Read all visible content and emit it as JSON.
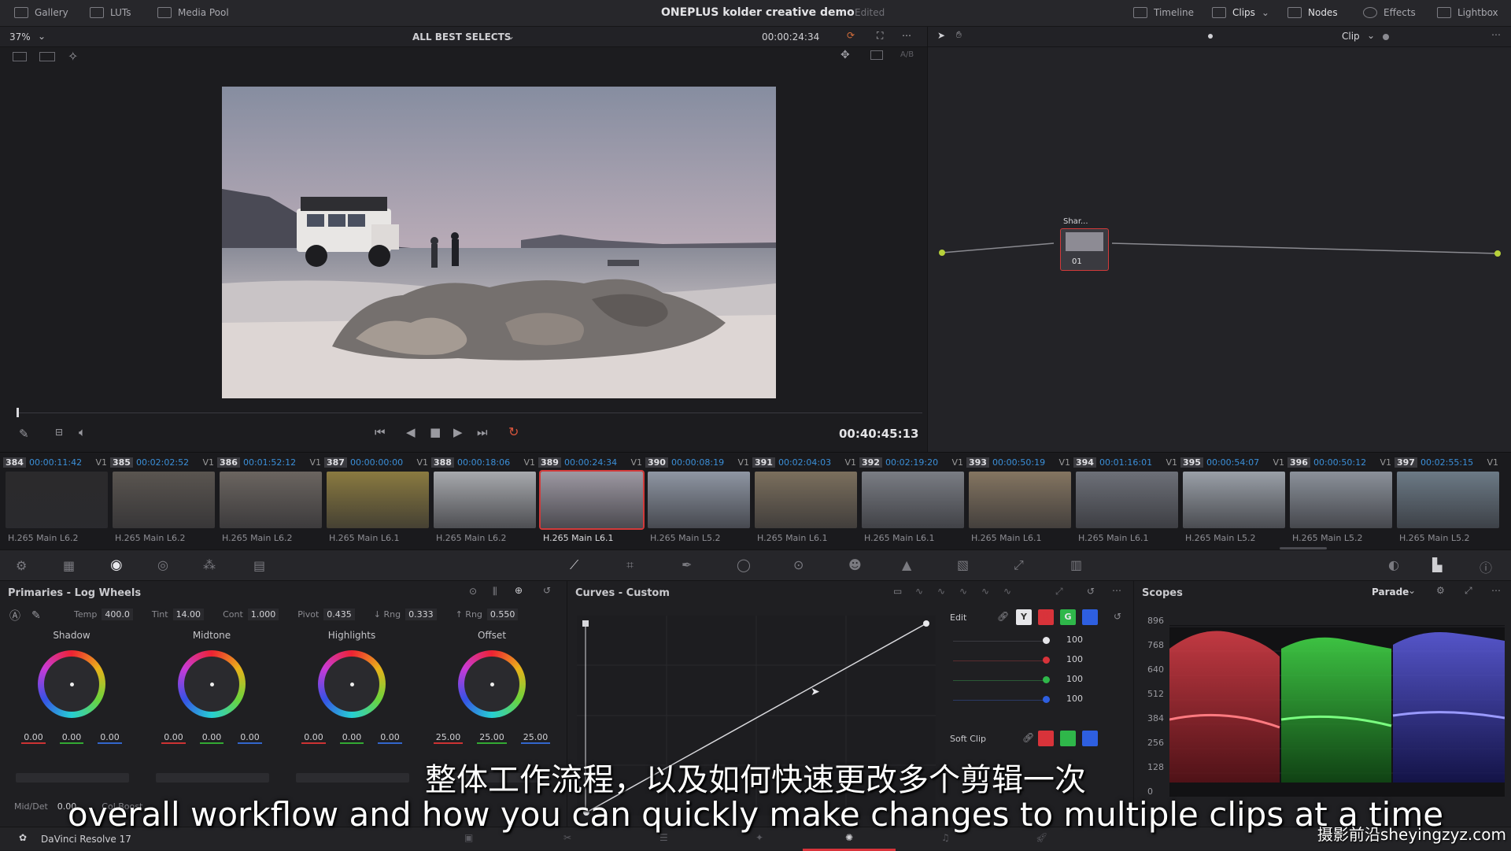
{
  "topbar": {
    "left": [
      {
        "label": "Gallery",
        "icon": "gallery-icon"
      },
      {
        "label": "LUTs",
        "icon": "luts-icon"
      },
      {
        "label": "Media Pool",
        "icon": "media-pool-icon"
      }
    ],
    "title": "ONEPLUS kolder creative demo",
    "status": "Edited",
    "right": [
      {
        "label": "Timeline",
        "icon": "timeline-icon"
      },
      {
        "label": "Clips",
        "icon": "clips-icon"
      },
      {
        "label": "Nodes",
        "icon": "nodes-icon"
      },
      {
        "label": "Effects",
        "icon": "effects-icon"
      },
      {
        "label": "Lightbox",
        "icon": "lightbox-icon"
      }
    ]
  },
  "viewer": {
    "zoom": "37%",
    "album": "ALL BEST SELECTS",
    "timecode": "00:00:24:34",
    "duration": "00:40:45:13",
    "ab_label": "A/B"
  },
  "nodes_panel": {
    "mode": "Clip",
    "node_label": "Shar...",
    "node_number": "01"
  },
  "clips": [
    {
      "num": "384",
      "tc": "00:00:11:42",
      "track": "V1",
      "codec": "H.265 Main L6.2",
      "thumb": "#2b2a2c"
    },
    {
      "num": "385",
      "tc": "00:02:02:52",
      "track": "V1",
      "codec": "H.265 Main L6.2",
      "thumb": "#5a5550"
    },
    {
      "num": "386",
      "tc": "00:01:52:12",
      "track": "V1",
      "codec": "H.265 Main L6.2",
      "thumb": "#6b6560"
    },
    {
      "num": "387",
      "tc": "00:00:00:00",
      "track": "V1",
      "codec": "H.265 Main L6.1",
      "thumb": "#8a7a40"
    },
    {
      "num": "388",
      "tc": "00:00:18:06",
      "track": "V1",
      "codec": "H.265 Main L6.2",
      "thumb": "#a7a9ad"
    },
    {
      "num": "389",
      "tc": "00:00:24:34",
      "track": "V1",
      "codec": "H.265 Main L6.1",
      "thumb": "#9d98a2",
      "selected": true
    },
    {
      "num": "390",
      "tc": "00:00:08:19",
      "track": "V1",
      "codec": "H.265 Main L5.2",
      "thumb": "#8f96a3"
    },
    {
      "num": "391",
      "tc": "00:02:04:03",
      "track": "V1",
      "codec": "H.265 Main L6.1",
      "thumb": "#7b6f5d"
    },
    {
      "num": "392",
      "tc": "00:02:19:20",
      "track": "V1",
      "codec": "H.265 Main L6.1",
      "thumb": "#7a7d84"
    },
    {
      "num": "393",
      "tc": "00:00:50:19",
      "track": "V1",
      "codec": "H.265 Main L6.1",
      "thumb": "#847561"
    },
    {
      "num": "394",
      "tc": "00:01:16:01",
      "track": "V1",
      "codec": "H.265 Main L6.1",
      "thumb": "#6d7078"
    },
    {
      "num": "395",
      "tc": "00:00:54:07",
      "track": "V1",
      "codec": "H.265 Main L5.2",
      "thumb": "#9aa0a8"
    },
    {
      "num": "396",
      "tc": "00:00:50:12",
      "track": "V1",
      "codec": "H.265 Main L5.2",
      "thumb": "#8b919a"
    },
    {
      "num": "397",
      "tc": "00:02:55:15",
      "track": "V1",
      "codec": "H.265 Main L5.2",
      "thumb": "#6c7a86"
    }
  ],
  "primaries": {
    "title": "Primaries - Log Wheels",
    "params": [
      {
        "label": "Temp",
        "value": "400.0"
      },
      {
        "label": "Tint",
        "value": "14.00"
      },
      {
        "label": "Cont",
        "value": "1.000"
      },
      {
        "label": "Pivot",
        "value": "0.435"
      },
      {
        "label": "↓ Rng",
        "value": "0.333"
      },
      {
        "label": "↑ Rng",
        "value": "0.550"
      }
    ],
    "wheels": [
      {
        "name": "Shadow",
        "values": [
          "0.00",
          "0.00",
          "0.00"
        ]
      },
      {
        "name": "Midtone",
        "values": [
          "0.00",
          "0.00",
          "0.00"
        ]
      },
      {
        "name": "Highlights",
        "values": [
          "0.00",
          "0.00",
          "0.00"
        ]
      },
      {
        "name": "Offset",
        "values": [
          "25.00",
          "25.00",
          "25.00"
        ]
      }
    ],
    "middet_label": "Mid/Det",
    "middet_value": "0.00",
    "colboost_label": "Col Boost"
  },
  "curves": {
    "title": "Curves - Custom",
    "edit_label": "Edit",
    "channels": [
      "Y",
      "R",
      "G",
      "B"
    ],
    "intensities": [
      "100",
      "100",
      "100",
      "100"
    ],
    "softclip_label": "Soft Clip"
  },
  "scopes": {
    "title": "Scopes",
    "mode": "Parade",
    "ticks": [
      "896",
      "768",
      "640",
      "512",
      "384",
      "256",
      "128",
      "0"
    ]
  },
  "status": {
    "app": "DaVinci Resolve 17"
  },
  "subtitles": {
    "cn": "整体工作流程，以及如何快速更改多个剪辑一次",
    "en": "overall workflow and how you can quickly make changes to multiple clips at a time"
  },
  "watermark": "摄影前沿sheyingzyz.com"
}
